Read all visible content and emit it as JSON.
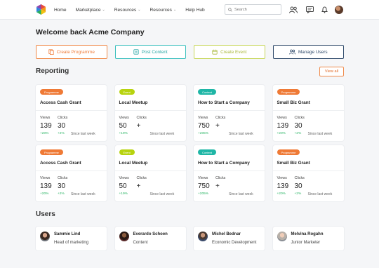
{
  "nav": {
    "items": [
      {
        "label": "Home",
        "has_dropdown": false
      },
      {
        "label": "Marketplace",
        "has_dropdown": true
      },
      {
        "label": "Resources",
        "has_dropdown": true
      },
      {
        "label": "Resources",
        "has_dropdown": true
      },
      {
        "label": "Help Hub",
        "has_dropdown": false
      }
    ],
    "search_placeholder": "Search"
  },
  "welcome": "Welcome back Acme Company",
  "actions": [
    {
      "label": "Create Programme",
      "icon": "programme-icon",
      "color": "#ef7a36"
    },
    {
      "label": "Post Content",
      "icon": "content-icon",
      "color": "#2ba8a6"
    },
    {
      "label": "Create Event",
      "icon": "calendar-icon",
      "color": "#aab93d"
    },
    {
      "label": "Manage Users",
      "icon": "users-icon",
      "color": "#2f4a6b"
    }
  ],
  "reporting": {
    "title": "Reporting",
    "view_all": "View all",
    "views_label": "Views",
    "clicks_label": "Clicks",
    "since_label": "Since last week",
    "cards": [
      {
        "badge": "Programme",
        "badge_color": "#ef7a36",
        "title": "Access Cash Grant",
        "views": "139",
        "clicks": "30",
        "views_change": "+20%",
        "clicks_change": "+2%"
      },
      {
        "badge": "Event",
        "badge_color": "#b7d30f",
        "title": "Local Meetup",
        "views": "50",
        "clicks": "+",
        "views_change": "+19%",
        "clicks_change": ""
      },
      {
        "badge": "Content",
        "badge_color": "#1fb6a6",
        "title": "How to Start a Company",
        "views": "750",
        "clicks": "+",
        "views_change": "+205%",
        "clicks_change": ""
      },
      {
        "badge": "Programme",
        "badge_color": "#ef7a36",
        "title": "Small Biz Grant",
        "views": "139",
        "clicks": "30",
        "views_change": "+20%",
        "clicks_change": "+2%"
      },
      {
        "badge": "Programme",
        "badge_color": "#ef7a36",
        "title": "Access Cash Grant",
        "views": "139",
        "clicks": "30",
        "views_change": "+20%",
        "clicks_change": "+2%"
      },
      {
        "badge": "Event",
        "badge_color": "#b7d30f",
        "title": "Local Meetup",
        "views": "50",
        "clicks": "+",
        "views_change": "+19%",
        "clicks_change": ""
      },
      {
        "badge": "Content",
        "badge_color": "#1fb6a6",
        "title": "How to Start a Company",
        "views": "750",
        "clicks": "+",
        "views_change": "+205%",
        "clicks_change": ""
      },
      {
        "badge": "Programme",
        "badge_color": "#ef7a36",
        "title": "Small Biz Grant",
        "views": "139",
        "clicks": "30",
        "views_change": "+20%",
        "clicks_change": "+2%"
      }
    ]
  },
  "users": {
    "title": "Users",
    "list": [
      {
        "name": "Sammie Lind",
        "role": "Head of marketing"
      },
      {
        "name": "Everardo Schoen",
        "role": "Content"
      },
      {
        "name": "Michel Bednar",
        "role": "Economic Development"
      },
      {
        "name": "Melvina Rogahn",
        "role": "Junior Marketer"
      }
    ]
  }
}
